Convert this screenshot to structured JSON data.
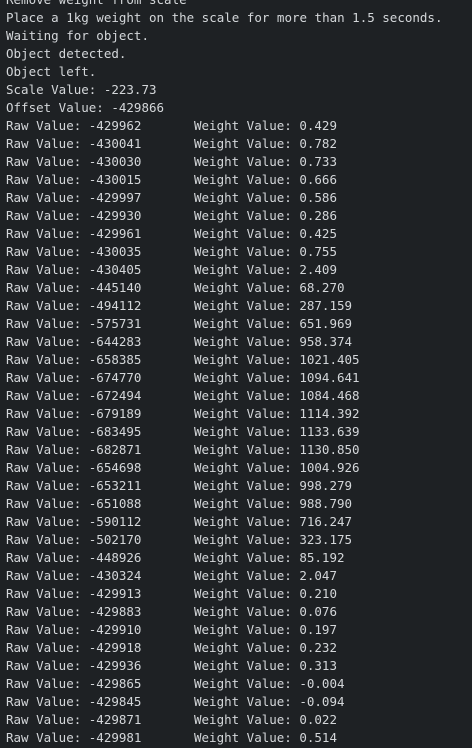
{
  "terminal": {
    "cut_line": "Remove weight from scale",
    "header_lines": [
      "Place a 1kg weight on the scale for more than 1.5 seconds.",
      "Waiting for object.",
      "Object detected.",
      "Object left.",
      "Scale Value: -223.73",
      "Offset Value: -429866"
    ],
    "readings": [
      {
        "raw": "Raw Value: -429962",
        "weight": "Weight Value: 0.429"
      },
      {
        "raw": "Raw Value: -430041",
        "weight": "Weight Value: 0.782"
      },
      {
        "raw": "Raw Value: -430030",
        "weight": "Weight Value: 0.733"
      },
      {
        "raw": "Raw Value: -430015",
        "weight": "Weight Value: 0.666"
      },
      {
        "raw": "Raw Value: -429997",
        "weight": "Weight Value: 0.586"
      },
      {
        "raw": "Raw Value: -429930",
        "weight": "Weight Value: 0.286"
      },
      {
        "raw": "Raw Value: -429961",
        "weight": "Weight Value: 0.425"
      },
      {
        "raw": "Raw Value: -430035",
        "weight": "Weight Value: 0.755"
      },
      {
        "raw": "Raw Value: -430405",
        "weight": "Weight Value: 2.409"
      },
      {
        "raw": "Raw Value: -445140",
        "weight": "Weight Value: 68.270"
      },
      {
        "raw": "Raw Value: -494112",
        "weight": "Weight Value: 287.159"
      },
      {
        "raw": "Raw Value: -575731",
        "weight": "Weight Value: 651.969"
      },
      {
        "raw": "Raw Value: -644283",
        "weight": "Weight Value: 958.374"
      },
      {
        "raw": "Raw Value: -658385",
        "weight": "Weight Value: 1021.405"
      },
      {
        "raw": "Raw Value: -674770",
        "weight": "Weight Value: 1094.641"
      },
      {
        "raw": "Raw Value: -672494",
        "weight": "Weight Value: 1084.468"
      },
      {
        "raw": "Raw Value: -679189",
        "weight": "Weight Value: 1114.392"
      },
      {
        "raw": "Raw Value: -683495",
        "weight": "Weight Value: 1133.639"
      },
      {
        "raw": "Raw Value: -682871",
        "weight": "Weight Value: 1130.850"
      },
      {
        "raw": "Raw Value: -654698",
        "weight": "Weight Value: 1004.926"
      },
      {
        "raw": "Raw Value: -653211",
        "weight": "Weight Value: 998.279"
      },
      {
        "raw": "Raw Value: -651088",
        "weight": "Weight Value: 988.790"
      },
      {
        "raw": "Raw Value: -590112",
        "weight": "Weight Value: 716.247"
      },
      {
        "raw": "Raw Value: -502170",
        "weight": "Weight Value: 323.175"
      },
      {
        "raw": "Raw Value: -448926",
        "weight": "Weight Value: 85.192"
      },
      {
        "raw": "Raw Value: -430324",
        "weight": "Weight Value: 2.047"
      },
      {
        "raw": "Raw Value: -429913",
        "weight": "Weight Value: 0.210"
      },
      {
        "raw": "Raw Value: -429883",
        "weight": "Weight Value: 0.076"
      },
      {
        "raw": "Raw Value: -429910",
        "weight": "Weight Value: 0.197"
      },
      {
        "raw": "Raw Value: -429918",
        "weight": "Weight Value: 0.232"
      },
      {
        "raw": "Raw Value: -429936",
        "weight": "Weight Value: 0.313"
      },
      {
        "raw": "Raw Value: -429865",
        "weight": "Weight Value: -0.004"
      },
      {
        "raw": "Raw Value: -429845",
        "weight": "Weight Value: -0.094"
      },
      {
        "raw": "Raw Value: -429871",
        "weight": "Weight Value: 0.022"
      },
      {
        "raw": "Raw Value: -429981",
        "weight": "Weight Value: 0.514"
      }
    ]
  }
}
